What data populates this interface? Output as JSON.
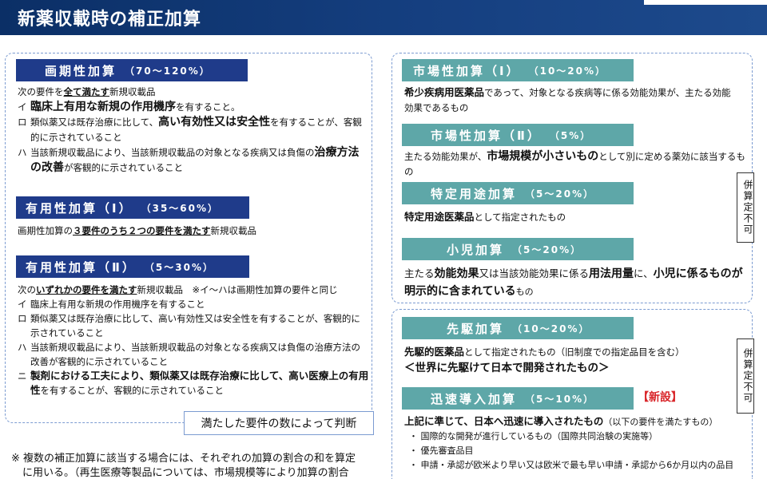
{
  "header": {
    "title": "新薬収載時の補正加算"
  },
  "epoch": {
    "title": "画期性加算",
    "range": "（70～120%）",
    "lead_pre": "次の要件を",
    "lead_bold": "全て満たす",
    "lead_post": "新規収載品",
    "items": [
      {
        "mark": "イ",
        "pre": "",
        "bold": "臨床上有用な新規の作用機序",
        "post": "を有すること。"
      },
      {
        "mark": "ロ",
        "pre": "類似薬又は既存治療に比して、",
        "bold": "高い有効性又は安全性",
        "post": "を有することが、客観的に示されていること"
      },
      {
        "mark": "ハ",
        "pre": "当該新規収載品により、当該新規収載品の対象となる疾病又は負傷の",
        "bold": "治療方法の改善",
        "post": "が客観的に示されていること"
      }
    ]
  },
  "useful1": {
    "title": "有用性加算（Ⅰ）",
    "range": "（35～60%）",
    "line_pre": "画期性加算の",
    "line_bold": "３要件のうち２つの要件を満たす",
    "line_post": "新規収載品"
  },
  "useful2": {
    "title": "有用性加算（Ⅱ）",
    "range": "（5～30%）",
    "lead_pre": "次の",
    "lead_bold": "いずれかの要件を満たす",
    "lead_post": "新規収載品　※イ～ハは画期性加算の要件と同じ",
    "items": [
      {
        "mark": "イ",
        "text": "臨床上有用な新規の作用機序を有すること"
      },
      {
        "mark": "ロ",
        "text": "類似薬又は既存治療に比して、高い有効性又は安全性を有することが、客観的に示されていること"
      },
      {
        "mark": "ハ",
        "text": "当該新規収載品により、当該新規収載品の対象となる疾病又は負傷の治療方法の改善が客観的に示されていること"
      },
      {
        "mark": "ニ",
        "text_bold": "製剤における工夫により、類似薬又は既存治療に比して、高い医療上の有用性",
        "text_post": "を有することが、客観的に示されていること"
      }
    ]
  },
  "judge_label": "満たした要件の数によって判断",
  "market1": {
    "title": "市場性加算（Ⅰ）",
    "range": "（10～20%）",
    "bold": "希少疾病用医薬品",
    "post": "であって、対象となる疾病等に係る効能効果が、主たる効能効果であるもの"
  },
  "market2": {
    "title": "市場性加算（Ⅱ）",
    "range": "（5%）",
    "pre": "主たる効能効果が、",
    "bold": "市場規模が小さいもの",
    "post": "として別に定める薬効に該当するもの"
  },
  "specific": {
    "title": "特定用途加算",
    "range": "（5～20%）",
    "bold": "特定用途医薬品",
    "post": "として指定されたもの"
  },
  "pediatric": {
    "title": "小児加算",
    "range": "（5～20%）",
    "p1": "主たる",
    "b1": "効能効果",
    "p2": "又は当該効能効果に係る",
    "b2": "用法用量",
    "p3": "に、",
    "b3": "小児に係るものが明示的に含まれている",
    "p4": "もの"
  },
  "side_label_1": "併算定不可",
  "pioneer": {
    "title": "先駆加算",
    "range": "（10～20%）",
    "bold": "先駆的医薬品",
    "post": "として指定されたもの（旧制度での指定品目を含む）",
    "slogan": "＜世界に先駆けて日本で開発されたもの＞"
  },
  "rapid": {
    "title": "迅速導入加算",
    "range": "（5～10%）",
    "new_tag": "【新設】",
    "lead_bold": "上記に準じて、日本へ迅速に導入されたもの",
    "lead_post": "（以下の要件を満たすもの）",
    "bullets": [
      "・ 国際的な開発が進行しているもの（国際共同治験の実施等）",
      "・ 優先審査品目",
      "・ 申請・承認が欧米より早い又は欧米で最も早い申請・承認から6か月以内の品目"
    ]
  },
  "side_label_2": "併算定不可",
  "footnote": {
    "line1": "※ 複数の補正加算に該当する場合には、それぞれの加算の割合の和を算定",
    "line2": "に用いる。（再生医療等製品については、市場規模等により加算の割合"
  }
}
